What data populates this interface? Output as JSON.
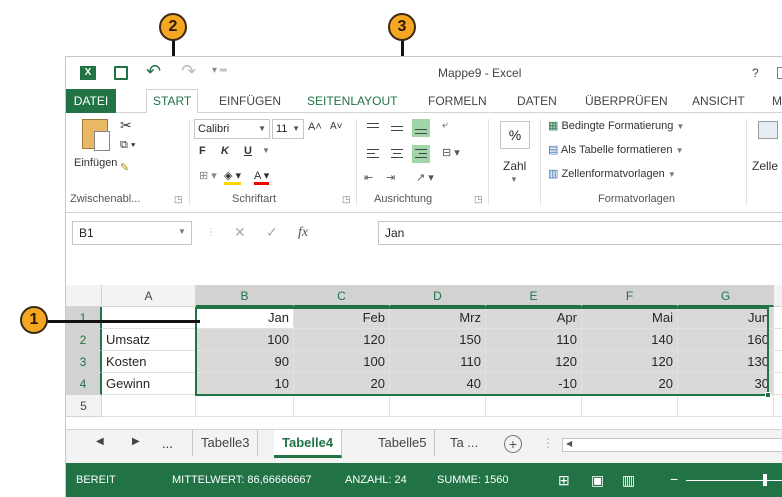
{
  "callouts": [
    "1",
    "2",
    "3"
  ],
  "titlebar": {
    "title": "Mappe9 - Excel",
    "help": "?"
  },
  "tabs": [
    {
      "label": "DATEI"
    },
    {
      "label": "START"
    },
    {
      "label": "EINFÜGEN"
    },
    {
      "label": "SEITENLAYOUT"
    },
    {
      "label": "FORMELN"
    },
    {
      "label": "DATEN"
    },
    {
      "label": "ÜBERPRÜFEN"
    },
    {
      "label": "ANSICHT"
    },
    {
      "label": "M"
    }
  ],
  "ribbon": {
    "paste_label": "Einfügen",
    "clipboard_label": "Zwischenabl...",
    "font_name": "Calibri",
    "font_size": "11",
    "bold": "F",
    "italic": "K",
    "underline": "U",
    "font_group_label": "Schriftart",
    "align_group_label": "Ausrichtung",
    "percent": "%",
    "number_label": "Zahl",
    "cond_format": "Bedingte Formatierung",
    "as_table": "Als Tabelle formatieren",
    "cell_styles": "Zellenformatvorlagen",
    "styles_group_label": "Formatvorlagen",
    "cells_label": "Zelle"
  },
  "formula": {
    "namebox": "B1",
    "fx": "fx",
    "value": "Jan"
  },
  "grid": {
    "columns": [
      "A",
      "B",
      "C",
      "D",
      "E",
      "F",
      "G"
    ],
    "rows": [
      "1",
      "2",
      "3",
      "4",
      "5"
    ],
    "cells": [
      [
        "",
        "Jan",
        "Feb",
        "Mrz",
        "Apr",
        "Mai",
        "Jun"
      ],
      [
        "Umsatz",
        "100",
        "120",
        "150",
        "110",
        "140",
        "160"
      ],
      [
        "Kosten",
        "90",
        "100",
        "110",
        "120",
        "120",
        "130"
      ],
      [
        "Gewinn",
        "10",
        "20",
        "40",
        "-10",
        "20",
        "30"
      ],
      [
        "",
        "",
        "",
        "",
        "",
        "",
        ""
      ]
    ]
  },
  "sheets": {
    "ellipsis": "...",
    "tabs": [
      "Tabelle3",
      "Tabelle4",
      "Tabelle5",
      "Ta ..."
    ],
    "active": "Tabelle4"
  },
  "status": {
    "ready": "BEREIT",
    "avg": "MITTELWERT: 86,66666667",
    "count": "ANZAHL: 24",
    "sum": "SUMME: 1560"
  },
  "colors": {
    "accent": "#217346",
    "callout": "#f5a623"
  }
}
